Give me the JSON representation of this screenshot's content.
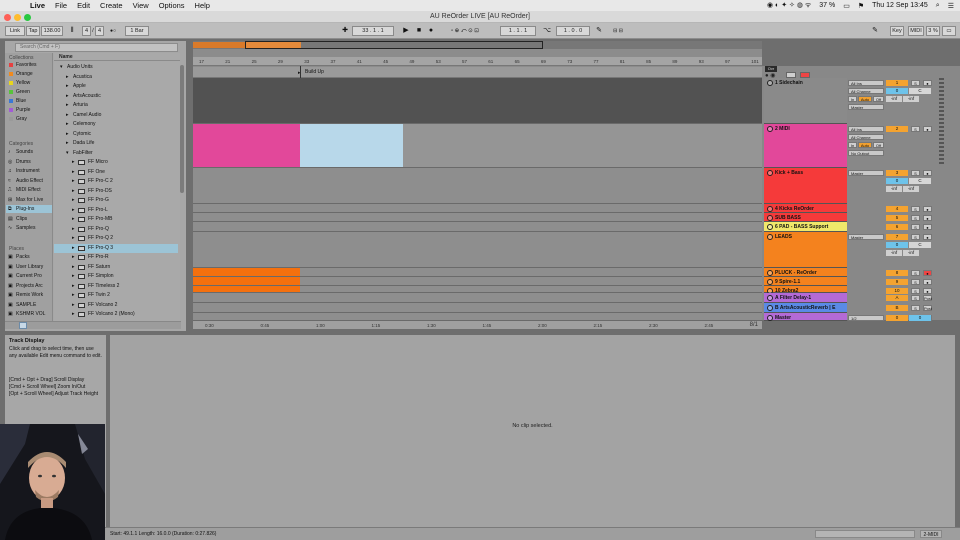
{
  "menubar": {
    "menus": [
      "Live",
      "File",
      "Edit",
      "Create",
      "View",
      "Options",
      "Help"
    ],
    "battery": "37 %",
    "clock": "Thu 12 Sep  13:45"
  },
  "window": {
    "title": "AU ReOrder LIVE  [AU ReOrder]"
  },
  "transport": {
    "link": "Link",
    "tap": "Tap",
    "tempo": "138.00",
    "sig_num": "4",
    "sig_den": "4",
    "metro": "1 Bar",
    "position": "33 . 1 . 1",
    "loop_start": "1 . 1 . 1",
    "loop_length": "1 . 0 . 0",
    "key": "Key",
    "midi": "MIDI",
    "cpu": "3 %"
  },
  "browser": {
    "search_placeholder": "Search (Cmd + F)",
    "collections_header": "Collections",
    "collections": [
      {
        "label": "Favorites",
        "color": "#e64040"
      },
      {
        "label": "Orange",
        "color": "#f08a1e"
      },
      {
        "label": "Yellow",
        "color": "#e7d51c"
      },
      {
        "label": "Green",
        "color": "#57c43a"
      },
      {
        "label": "Blue",
        "color": "#3a78d6"
      },
      {
        "label": "Purple",
        "color": "#a25bd6"
      },
      {
        "label": "Gray",
        "color": "#9a9a9a"
      }
    ],
    "categories_header": "Categories",
    "categories": [
      "Sounds",
      "Drums",
      "Instrument",
      "Audio Effect",
      "MIDI Effect",
      "Max for Live",
      "Plug-Ins",
      "Clips",
      "Samples"
    ],
    "places_header": "Places",
    "places": [
      "Packs",
      "User Library",
      "Current Pro",
      "Projects Arc",
      "Remix Work",
      "SAMPLE",
      "KSHMR VOL"
    ],
    "list_header": "Name",
    "items": [
      {
        "label": "Audio Units",
        "indent": 0,
        "open": true
      },
      {
        "label": "Acustica",
        "indent": 1
      },
      {
        "label": "Apple",
        "indent": 1
      },
      {
        "label": "ArtsAcoustic",
        "indent": 1
      },
      {
        "label": "Arturia",
        "indent": 1
      },
      {
        "label": "Camel Audio",
        "indent": 1
      },
      {
        "label": "Celemony",
        "indent": 1
      },
      {
        "label": "Cytomic",
        "indent": 1
      },
      {
        "label": "Dada Life",
        "indent": 1
      },
      {
        "label": "FabFilter",
        "indent": 1,
        "open": true
      },
      {
        "label": "FF Micro",
        "indent": 2,
        "plugin": true
      },
      {
        "label": "FF One",
        "indent": 2,
        "plugin": true
      },
      {
        "label": "FF Pro-C 2",
        "indent": 2,
        "plugin": true
      },
      {
        "label": "FF Pro-DS",
        "indent": 2,
        "plugin": true
      },
      {
        "label": "FF Pro-G",
        "indent": 2,
        "plugin": true
      },
      {
        "label": "FF Pro-L",
        "indent": 2,
        "plugin": true
      },
      {
        "label": "FF Pro-MB",
        "indent": 2,
        "plugin": true
      },
      {
        "label": "FF Pro-Q",
        "indent": 2,
        "plugin": true
      },
      {
        "label": "FF Pro-Q 2",
        "indent": 2,
        "plugin": true
      },
      {
        "label": "FF Pro-Q 3",
        "indent": 2,
        "plugin": true,
        "selected": true
      },
      {
        "label": "FF Pro-R",
        "indent": 2,
        "plugin": true
      },
      {
        "label": "FF Saturn",
        "indent": 2,
        "plugin": true
      },
      {
        "label": "FF Simplon",
        "indent": 2,
        "plugin": true
      },
      {
        "label": "FF Timeless 2",
        "indent": 2,
        "plugin": true
      },
      {
        "label": "FF Twin 2",
        "indent": 2,
        "plugin": true
      },
      {
        "label": "FF Volcano 2",
        "indent": 2,
        "plugin": true
      },
      {
        "label": "FF Volcano 2 (Mono)",
        "indent": 2,
        "plugin": true
      }
    ]
  },
  "arrangement": {
    "ruler": [
      "17",
      "21",
      "25",
      "29",
      "33",
      "37",
      "41",
      "45",
      "49",
      "53",
      "57",
      "61",
      "65",
      "69",
      "73",
      "77",
      "81",
      "85",
      "89",
      "93",
      "97",
      "101"
    ],
    "locator": "Build Up",
    "time_labels": [
      "0:30",
      "0:45",
      "1:00",
      "1:15",
      "1:30",
      "1:45",
      "2:00",
      "2:15",
      "2:30",
      "2:45"
    ],
    "zoom_label": "8/1"
  },
  "tracks": [
    {
      "name": "1 Sidechain",
      "color": "#8a8a8a",
      "num": "1",
      "input": "All Ins",
      "channel": "All Channe",
      "monitor_in": "In",
      "monitor_auto": "Auto",
      "monitor_off": "Off",
      "output": "Master",
      "vol": "0",
      "pan": "C",
      "send_a": "-inf",
      "send_b": "-inf"
    },
    {
      "name": "2 MIDI",
      "color": "#e2489a",
      "num": "2",
      "input": "All Ins",
      "channel": "All Channe",
      "monitor_in": "In",
      "monitor_auto": "Auto",
      "monitor_off": "Off",
      "output": "No Output"
    },
    {
      "name": "Kick + Bass",
      "color": "#f53a3a",
      "num": "3",
      "output": "Master",
      "vol": "0",
      "pan": "C",
      "send_a": "-inf",
      "send_b": "-inf"
    },
    {
      "name": "4 Kicks ReOrder",
      "color": "#f53a3a",
      "num": "4"
    },
    {
      "name": "SUB BASS",
      "color": "#f53a3a",
      "num": "5"
    },
    {
      "name": "6 PAD - BASS Support",
      "color": "#f0e86a",
      "num": "6"
    },
    {
      "name": "LEADS",
      "color": "#f4821e",
      "num": "7",
      "output": "Master",
      "vol": "0",
      "pan": "C",
      "send_a": "-inf",
      "send_b": "-inf"
    },
    {
      "name": "PLUCK - ReOrder",
      "color": "#f4821e",
      "num": "8"
    },
    {
      "name": "9 Spire-1.1",
      "color": "#f4821e",
      "num": "9"
    },
    {
      "name": "10 Zebra2",
      "color": "#f4821e",
      "num": "10"
    },
    {
      "name": "A Filter Delay-1",
      "color": "#b46ad6",
      "num": "A",
      "post": "Post"
    },
    {
      "name": "B ArtsAcousticReverb | E",
      "color": "#5a8ae6",
      "num": "B",
      "post": "Post"
    },
    {
      "name": "Master",
      "color": "#b46ad6",
      "num": "0",
      "output": "1/2",
      "pan": "0"
    }
  ],
  "info_view": {
    "title": "Track Display",
    "body": "Click and drag to select time, then use any available Edit menu command to edit.",
    "shortcut1": "[Cmd + Opt + Drag] Scroll Display",
    "shortcut2": "[Cmd + Scroll Wheel] Zoom In/Out",
    "shortcut3": "[Opt + Scroll Wheel] Adjust Track Height"
  },
  "detail": {
    "empty": "No clip selected."
  },
  "statusbar": {
    "text": "Start: 49.1.1   Length: 16.0.0  (Duration: 0:27.826)",
    "midi": "2-MIDI"
  }
}
